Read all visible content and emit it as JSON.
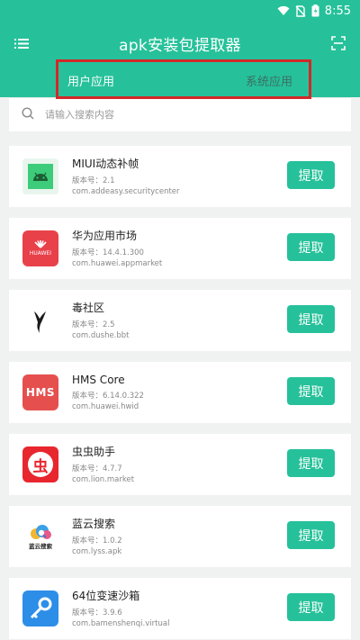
{
  "status_bar": {
    "time": "8:55"
  },
  "app_bar": {
    "title": "apk安装包提取器"
  },
  "tabs": [
    {
      "label": "用户应用",
      "active": true
    },
    {
      "label": "系统应用",
      "active": false
    }
  ],
  "search": {
    "placeholder": "请输入搜索内容"
  },
  "colors": {
    "accent": "#26c19a",
    "highlight_box": "#d32828"
  },
  "apps": [
    {
      "name": "MIUI动态补帧",
      "version": "版本号：2.1",
      "package": "com.addeasy.securitycenter",
      "action": "提取",
      "icon": "android-icon"
    },
    {
      "name": "华为应用市场",
      "version": "版本号：14.4.1.300",
      "package": "com.huawei.appmarket",
      "action": "提取",
      "icon": "huawei-icon",
      "icon_text": "HUAWEI"
    },
    {
      "name": "毒社区",
      "version": "版本号：2.5",
      "package": "com.dushe.bbt",
      "action": "提取",
      "icon": "dushe-icon"
    },
    {
      "name": "HMS Core",
      "version": "版本号：6.14.0.322",
      "package": "com.huawei.hwid",
      "action": "提取",
      "icon": "hms-icon",
      "icon_text": "HMS"
    },
    {
      "name": "虫虫助手",
      "version": "版本号：4.7.7",
      "package": "com.lion.market",
      "action": "提取",
      "icon": "chongchong-icon",
      "icon_text": "虫"
    },
    {
      "name": "蓝云搜索",
      "version": "版本号：1.0.2",
      "package": "com.lyss.apk",
      "action": "提取",
      "icon": "lanyun-icon",
      "icon_text": "蓝云搜索"
    },
    {
      "name": "64位变速沙箱",
      "version": "版本号：3.9.6",
      "package": "com.bamenshenqi.virtual",
      "action": "提取",
      "icon": "key-icon"
    }
  ]
}
